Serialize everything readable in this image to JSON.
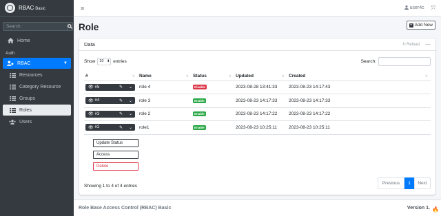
{
  "sidebar": {
    "brand": "RBAC",
    "brand_small": "Basic",
    "search_placeholder": "Search",
    "home": "Home",
    "section": "Auth",
    "rbac": "RBAC",
    "items": [
      {
        "label": "Resources"
      },
      {
        "label": "Category Resource"
      },
      {
        "label": "Groups"
      },
      {
        "label": "Roles"
      },
      {
        "label": "Users"
      }
    ]
  },
  "topbar": {
    "user": "user4c"
  },
  "page": {
    "title": "Role",
    "add_new": "Add New"
  },
  "card": {
    "title": "Data",
    "reload": "Reload",
    "show": "Show",
    "entries_value": "10",
    "entries": "entries",
    "search": "Search:",
    "columns": [
      "#",
      "Name",
      "Status",
      "Updated",
      "Created"
    ],
    "rows": [
      {
        "id": "#5",
        "name": "role 4",
        "status": "Disable",
        "updated": "2023-08-28 13:41:33",
        "created": "2023-08-23 14:17:43"
      },
      {
        "id": "#4",
        "name": "role 3",
        "status": "Enable",
        "updated": "2023-08-23 14:17:33",
        "created": "2023-08-23 14:17:33"
      },
      {
        "id": "#3",
        "name": "role 2",
        "status": "Enable",
        "updated": "2023-08-23 14:17:22",
        "created": "2023-08-23 14:17:22"
      },
      {
        "id": "#2",
        "name": "role1",
        "status": "Enable",
        "updated": "2023-08-23 10:25:11",
        "created": "2023-08-23 10:25:11"
      }
    ],
    "dropdown": {
      "update_status": "Update Status",
      "access": "Access",
      "delete": "Delete"
    },
    "info": "Showing 1 to 4 of 4 entries",
    "pager": {
      "previous": "Previous",
      "page": "1",
      "next": "Next"
    }
  },
  "footer": {
    "text": "Role Base Access Control (RBAC) Basic",
    "version": "Version 1."
  },
  "colors": {
    "sidebar": "#343a40",
    "accent": "#007bff",
    "danger": "#dc3545",
    "success": "#28a745"
  }
}
